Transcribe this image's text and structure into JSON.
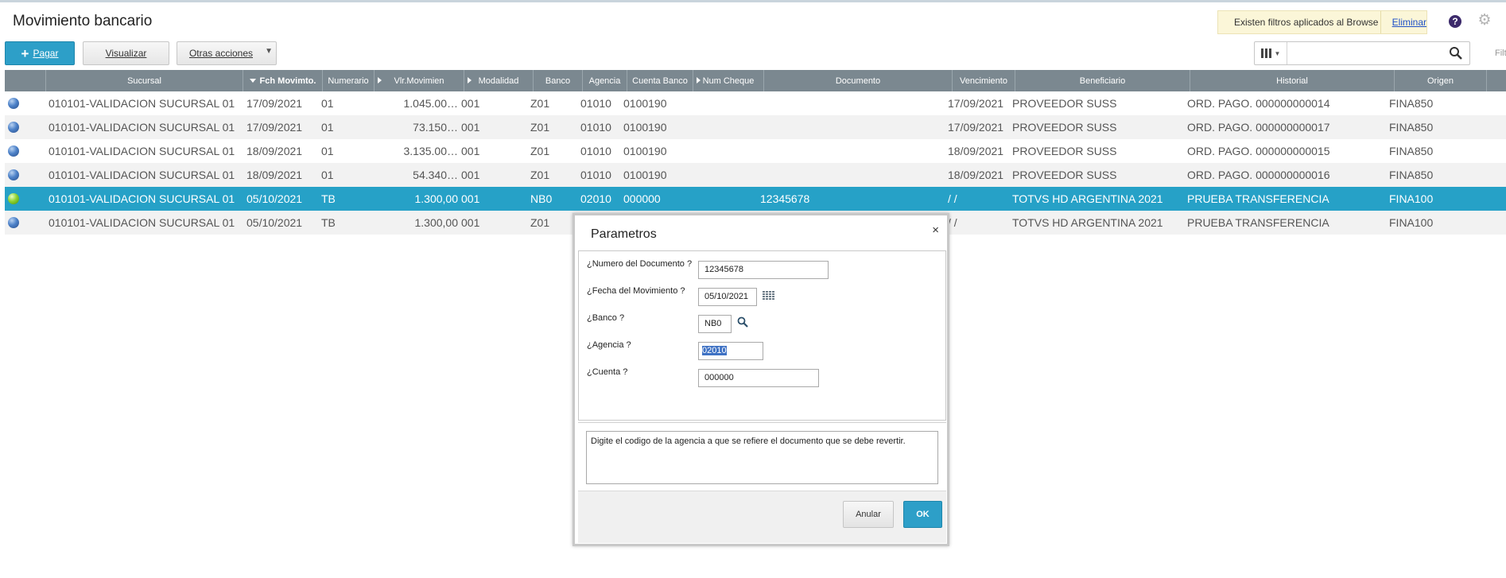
{
  "page": {
    "title": "Movimiento bancario"
  },
  "filter_banner": {
    "message": "Existen filtros aplicados al Browse",
    "remove_link": "Eliminar"
  },
  "header_icons": {
    "help": "help-icon",
    "settings": "gear-icon"
  },
  "toolbar": {
    "pay_label": "Pagar",
    "view_label": "Visualizar",
    "more_label": "Otras acciones",
    "search_value": "",
    "filter_label": "Filt"
  },
  "grid": {
    "columns": [
      "",
      "Sucursal",
      "Fch Movimto.",
      "Numerario",
      "Vlr.Movimien",
      "Modalidad",
      "Banco",
      "Agencia",
      "Cuenta Banco",
      "Num Cheque",
      "Documento",
      "Vencimiento",
      "Beneficiario",
      "Historial",
      "Origen"
    ],
    "sorted_column": "Fch Movimto.",
    "rows": [
      {
        "status": "blue",
        "sucursal": "010101-VALIDACION SUCURSAL 01",
        "fecha": "17/09/2021",
        "numerario": "01",
        "valor": "1.045.00…",
        "modalidad": "001",
        "banco": "Z01",
        "agencia": "01010",
        "cuenta": "0100190",
        "cheque": "",
        "documento": "",
        "vencimiento": "17/09/2021",
        "beneficiario": "PROVEEDOR SUSS",
        "historial": "ORD. PAGO.  000000000014",
        "origen": "FINA850"
      },
      {
        "status": "blue",
        "sucursal": "010101-VALIDACION SUCURSAL 01",
        "fecha": "17/09/2021",
        "numerario": "01",
        "valor": "73.150…",
        "modalidad": "001",
        "banco": "Z01",
        "agencia": "01010",
        "cuenta": "0100190",
        "cheque": "",
        "documento": "",
        "vencimiento": "17/09/2021",
        "beneficiario": "PROVEEDOR SUSS",
        "historial": "ORD. PAGO.  000000000017",
        "origen": "FINA850"
      },
      {
        "status": "blue",
        "sucursal": "010101-VALIDACION SUCURSAL 01",
        "fecha": "18/09/2021",
        "numerario": "01",
        "valor": "3.135.00…",
        "modalidad": "001",
        "banco": "Z01",
        "agencia": "01010",
        "cuenta": "0100190",
        "cheque": "",
        "documento": "",
        "vencimiento": "18/09/2021",
        "beneficiario": "PROVEEDOR SUSS",
        "historial": "ORD. PAGO.  000000000015",
        "origen": "FINA850"
      },
      {
        "status": "blue",
        "sucursal": "010101-VALIDACION SUCURSAL 01",
        "fecha": "18/09/2021",
        "numerario": "01",
        "valor": "54.340…",
        "modalidad": "001",
        "banco": "Z01",
        "agencia": "01010",
        "cuenta": "0100190",
        "cheque": "",
        "documento": "",
        "vencimiento": "18/09/2021",
        "beneficiario": "PROVEEDOR SUSS",
        "historial": "ORD. PAGO.  000000000016",
        "origen": "FINA850"
      },
      {
        "status": "green",
        "sucursal": "010101-VALIDACION SUCURSAL 01",
        "fecha": "05/10/2021",
        "numerario": "TB",
        "valor": "1.300,00",
        "modalidad": "001",
        "banco": "NB0",
        "agencia": "02010",
        "cuenta": "000000",
        "cheque": "",
        "documento": "12345678",
        "vencimiento": " /  /",
        "beneficiario": "TOTVS HD ARGENTINA 2021",
        "historial": "PRUEBA TRANSFERENCIA",
        "origen": "FINA100"
      },
      {
        "status": "blue",
        "sucursal": "010101-VALIDACION SUCURSAL 01",
        "fecha": "05/10/2021",
        "numerario": "TB",
        "valor": "1.300,00",
        "modalidad": "001",
        "banco": "Z01",
        "agencia": "",
        "cuenta": "",
        "cheque": "",
        "documento": "",
        "vencimiento": " /  /",
        "beneficiario": "TOTVS HD ARGENTINA 2021",
        "historial": "PRUEBA TRANSFERENCIA",
        "origen": "FINA100"
      }
    ],
    "selected_row": 4
  },
  "dialog": {
    "title": "Parametros",
    "close_glyph": "×",
    "fields": [
      {
        "label": "¿Numero del Documento ?",
        "value": "12345678"
      },
      {
        "label": "¿Fecha del Movimiento ?",
        "value": "05/10/2021"
      },
      {
        "label": "¿Banco ?",
        "value": "NB0"
      },
      {
        "label": "¿Agencia ?",
        "value": "02010"
      },
      {
        "label": "¿Cuenta ?",
        "value": "000000"
      }
    ],
    "help_text": "Digite el codigo de la agencia a que se refiere el documento que se debe revertir.",
    "cancel_label": "Anular",
    "ok_label": "OK"
  },
  "colors": {
    "accent": "#2d9fc8",
    "header_bg": "#7b8890",
    "selected_row": "#26a1c7",
    "filter_banner": "#fbf6d8"
  }
}
